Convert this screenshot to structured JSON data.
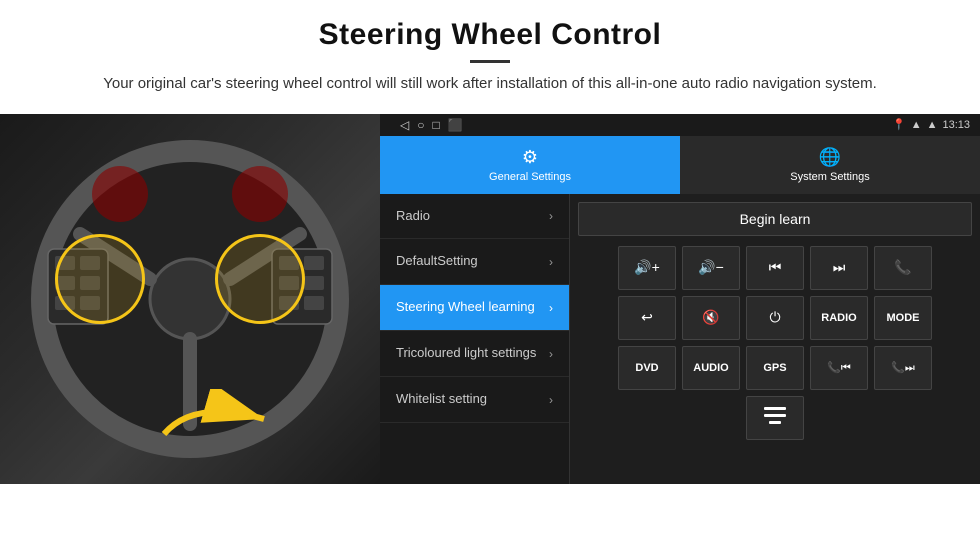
{
  "header": {
    "title": "Steering Wheel Control",
    "subtitle": "Your original car's steering wheel control will still work after installation of this all-in-one auto radio navigation system."
  },
  "tabs": [
    {
      "label": "General Settings",
      "icon": "⚙",
      "active": true
    },
    {
      "label": "System Settings",
      "icon": "🌐",
      "active": false
    }
  ],
  "statusBar": {
    "time": "13:13",
    "navIcons": [
      "◁",
      "○",
      "□",
      "⬛"
    ]
  },
  "menuItems": [
    {
      "label": "Radio",
      "active": false
    },
    {
      "label": "DefaultSetting",
      "active": false
    },
    {
      "label": "Steering Wheel learning",
      "active": true
    },
    {
      "label": "Tricoloured light settings",
      "active": false
    },
    {
      "label": "Whitelist setting",
      "active": false
    }
  ],
  "controls": {
    "beginLearn": "Begin learn",
    "row1": [
      "🔊+",
      "🔊−",
      "⏮",
      "⏭",
      "📞"
    ],
    "row1Icons": [
      "vol-up",
      "vol-down",
      "prev-track",
      "next-track",
      "phone"
    ],
    "row2Icons": [
      "phone-end",
      "mute",
      "power",
      "radio",
      "mode"
    ],
    "row2Labels": [
      "↩",
      "🔇",
      "⏻",
      "RADIO",
      "MODE"
    ],
    "row3Labels": [
      "DVD",
      "AUDIO",
      "GPS",
      "⏮",
      "⏭"
    ],
    "row3Icons": [
      "dvd",
      "audio",
      "gps",
      "seek-prev",
      "seek-next"
    ],
    "row4Icons": [
      "menu-icon"
    ],
    "row4Labels": [
      "≡"
    ]
  }
}
